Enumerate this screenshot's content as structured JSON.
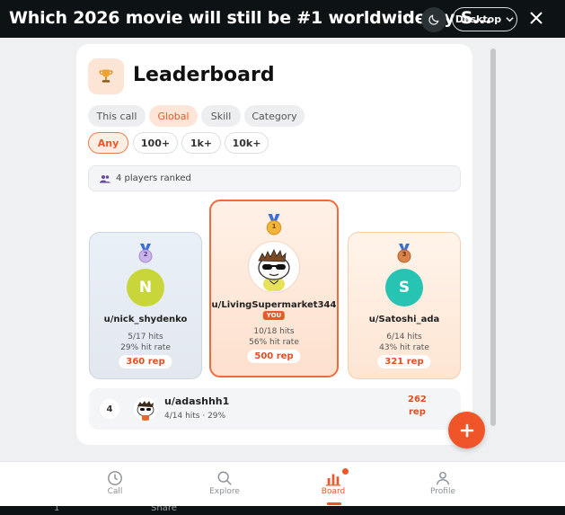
{
  "topbar": {
    "title": "Which 2026 movie will still be #1 worldwide by S...",
    "more_icon": "more-dots-icon",
    "theme_icon": "moon-icon",
    "desktop_label": "Desktop",
    "close_icon": "close-icon"
  },
  "leaderboard": {
    "title": "Leaderboard",
    "scope_tabs": [
      "This call",
      "Global",
      "Skill",
      "Category"
    ],
    "active_scope": "Global",
    "threshold_tabs": [
      "Any",
      "100+",
      "1k+",
      "10k+"
    ],
    "active_threshold": "Any",
    "players_ranked": "4 players ranked"
  },
  "podium": [
    {
      "rank": "2",
      "initial": "N",
      "username": "u/nick_shydenko",
      "hits": "5/17 hits",
      "hit_rate": "29% hit rate",
      "rep": "360 rep",
      "avatar_color": "#c9d63a"
    },
    {
      "rank": "1",
      "initial": "",
      "username": "u/LivingSupermarket344",
      "you": "YOU",
      "hits": "10/18 hits",
      "hit_rate": "56% hit rate",
      "rep": "500 rep"
    },
    {
      "rank": "3",
      "initial": "S",
      "username": "u/Satoshi_ada",
      "hits": "6/14 hits",
      "hit_rate": "43% hit rate",
      "rep": "321 rep",
      "avatar_color": "#27c3b3"
    }
  ],
  "rows": [
    {
      "rank": "4",
      "username": "u/adashhh1",
      "stats": "4/14 hits · 29%",
      "rep_value": "262",
      "rep_unit": "rep"
    }
  ],
  "fab_icon": "plus-icon",
  "nav": [
    {
      "label": "Call",
      "icon": "clock-icon"
    },
    {
      "label": "Explore",
      "icon": "search-icon"
    },
    {
      "label": "Board",
      "icon": "bar-chart-icon",
      "active": true
    },
    {
      "label": "Profile",
      "icon": "user-icon"
    }
  ],
  "bottom_strip": {
    "count": "1",
    "share": "Share"
  },
  "colors": {
    "accent": "#e8582a",
    "dark": "#0d1214"
  }
}
